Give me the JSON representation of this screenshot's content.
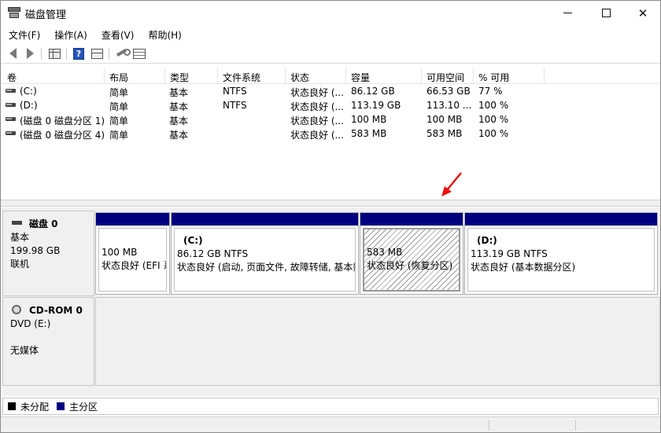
{
  "window": {
    "title": "磁盘管理",
    "controls": {
      "minimize": "",
      "maximize": "",
      "close": "✕"
    }
  },
  "menu": [
    "文件(F)",
    "操作(A)",
    "查看(V)",
    "帮助(H)"
  ],
  "toolbar": [
    "back-icon",
    "forward-icon",
    "console-grid-icon",
    "help-icon",
    "show-pane-icon",
    "connect-icon",
    "properties-icon"
  ],
  "volume_list": {
    "columns": [
      "卷",
      "布局",
      "类型",
      "文件系统",
      "状态",
      "容量",
      "可用空间",
      "% 可用"
    ],
    "rows": [
      {
        "name": "(C:)",
        "layout": "简单",
        "type": "基本",
        "fs": "NTFS",
        "status": "状态良好 (...",
        "capacity": "86.12 GB",
        "free": "66.53 GB",
        "pct": "77 %"
      },
      {
        "name": "(D:)",
        "layout": "简单",
        "type": "基本",
        "fs": "NTFS",
        "status": "状态良好 (...",
        "capacity": "113.19 GB",
        "free": "113.10 ...",
        "pct": "100 %"
      },
      {
        "name": "(磁盘 0 磁盘分区 1)",
        "layout": "简单",
        "type": "基本",
        "fs": "",
        "status": "状态良好 (...",
        "capacity": "100 MB",
        "free": "100 MB",
        "pct": "100 %"
      },
      {
        "name": "(磁盘 0 磁盘分区 4)",
        "layout": "简单",
        "type": "基本",
        "fs": "",
        "status": "状态良好 (...",
        "capacity": "583 MB",
        "free": "583 MB",
        "pct": "100 %"
      }
    ]
  },
  "disk0": {
    "title": "磁盘 0",
    "type": "基本",
    "size": "199.98 GB",
    "state": "联机",
    "partitions": [
      {
        "name": "",
        "size": "100 MB",
        "status": "状态良好 (EFI 系统分区)"
      },
      {
        "name": "(C:)",
        "size": "86.12 GB NTFS",
        "status": "状态良好 (启动, 页面文件, 故障转储, 基本数据分区)"
      },
      {
        "name": "",
        "size": "583 MB",
        "status": "状态良好 (恢复分区)"
      },
      {
        "name": "(D:)",
        "size": "113.19 GB NTFS",
        "status": "状态良好 (基本数据分区)"
      }
    ]
  },
  "cdrom0": {
    "title": "CD-ROM 0",
    "drive": "DVD (E:)",
    "media": "无媒体"
  },
  "legend": [
    {
      "label": "未分配",
      "color": "#000000"
    },
    {
      "label": "主分区",
      "color": "#00007f"
    }
  ],
  "colors": {
    "primary_partition": "#00007f",
    "annotation_arrow": "#e8140c"
  }
}
